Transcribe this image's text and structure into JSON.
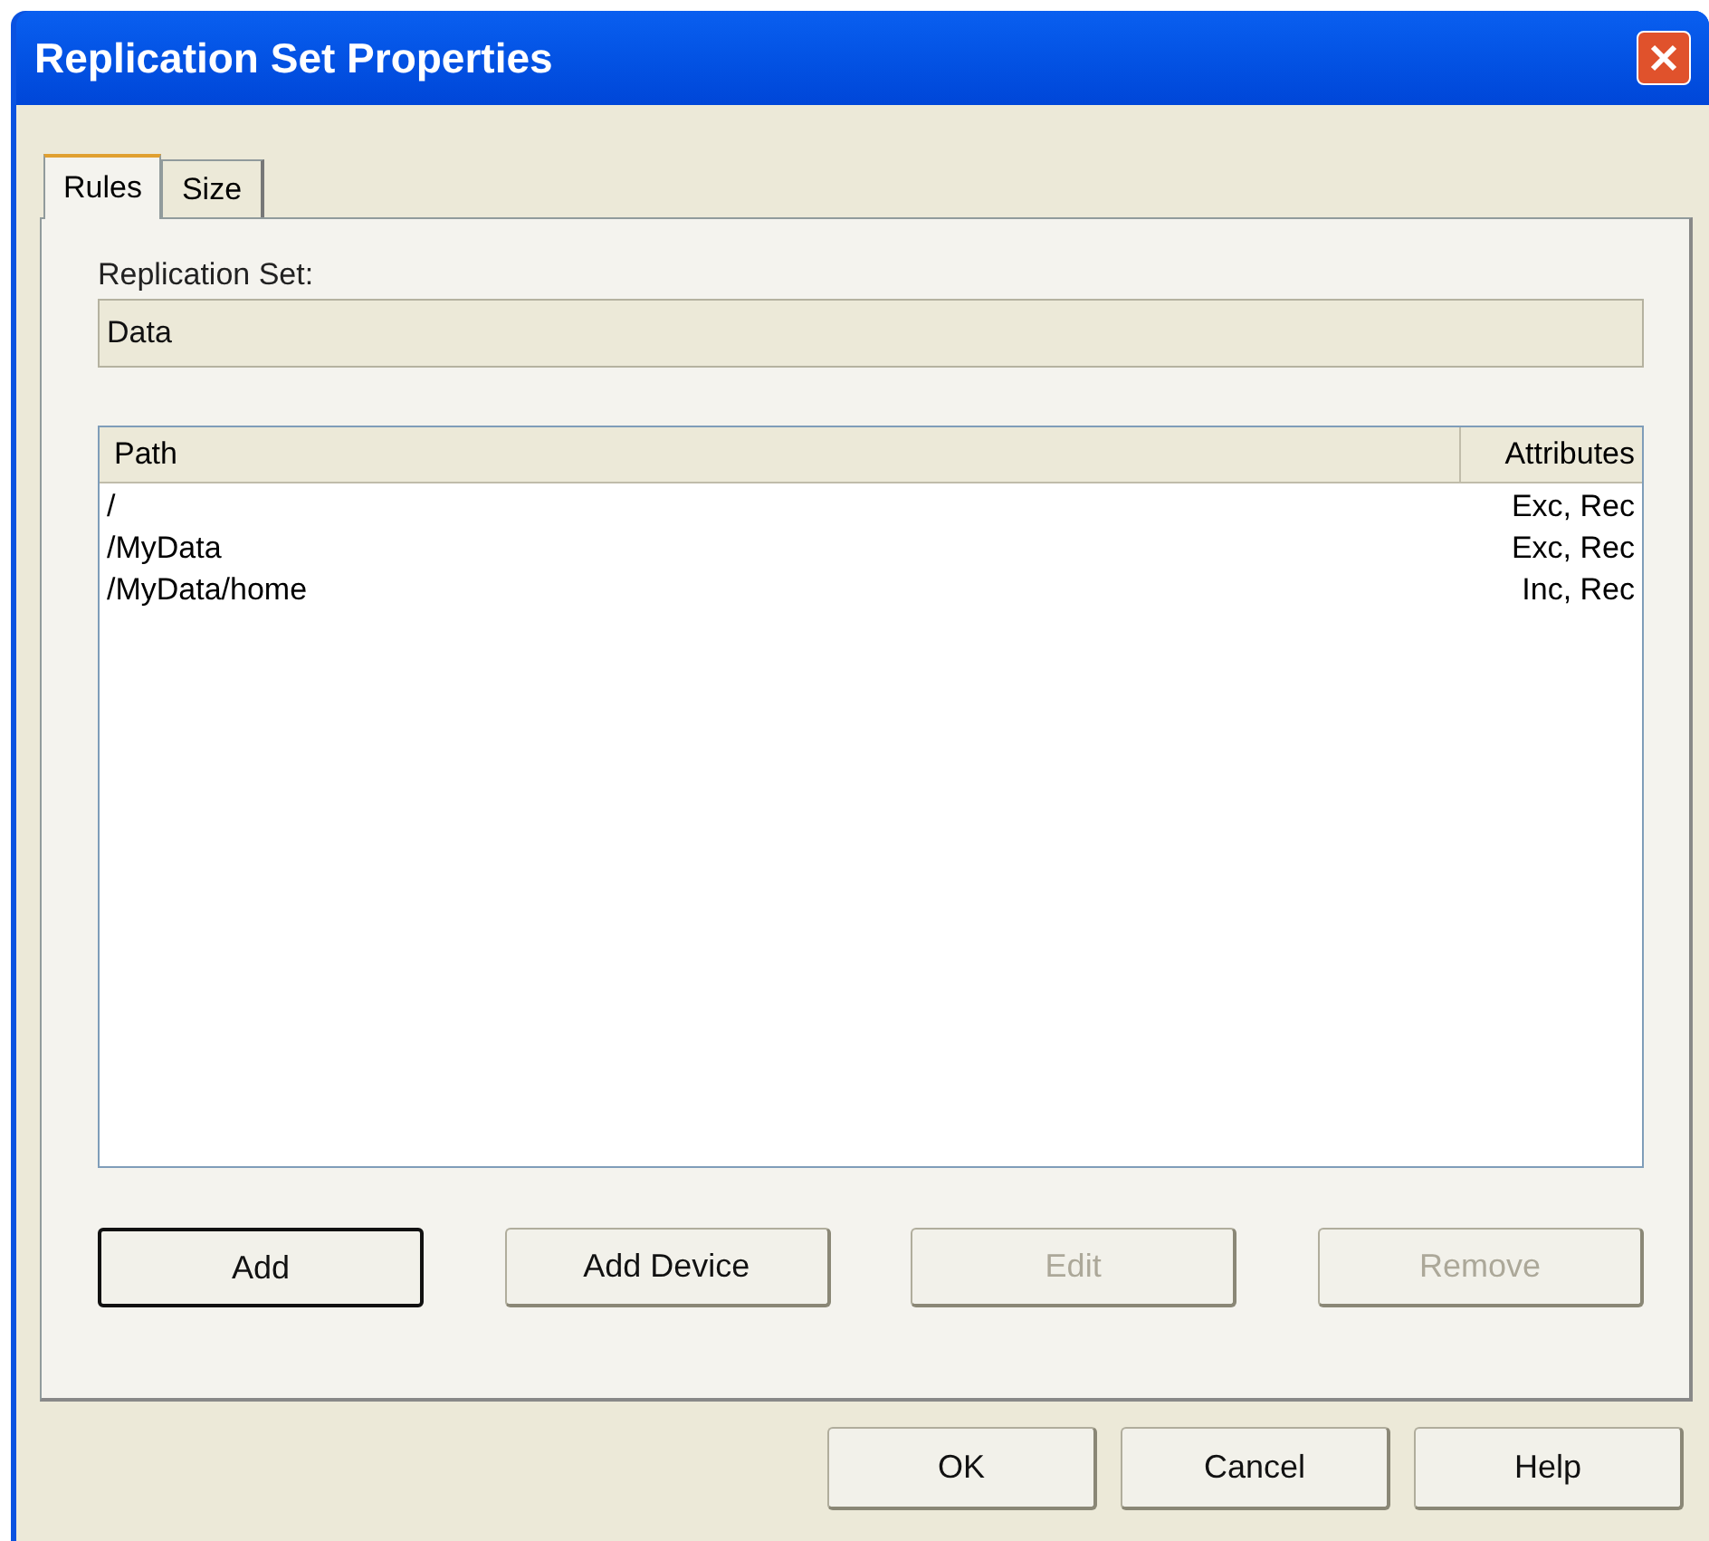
{
  "window": {
    "title": "Replication Set Properties"
  },
  "tabs": [
    {
      "label": "Rules",
      "selected": true
    },
    {
      "label": "Size",
      "selected": false
    }
  ],
  "replication_set": {
    "label": "Replication Set:",
    "value": "Data"
  },
  "table": {
    "columns": [
      "Path",
      "Attributes"
    ],
    "rows": [
      [
        "/",
        "Exc, Rec"
      ],
      [
        "/MyData",
        "Exc, Rec"
      ],
      [
        "/MyData/home",
        "Inc, Rec"
      ]
    ]
  },
  "rule_buttons": [
    {
      "label": "Add",
      "disabled": false,
      "default": true
    },
    {
      "label": "Add Device",
      "disabled": false,
      "default": false
    },
    {
      "label": "Edit",
      "disabled": true,
      "default": false
    },
    {
      "label": "Remove",
      "disabled": true,
      "default": false
    }
  ],
  "dialog_buttons": [
    {
      "label": "OK"
    },
    {
      "label": "Cancel"
    },
    {
      "label": "Help"
    }
  ]
}
